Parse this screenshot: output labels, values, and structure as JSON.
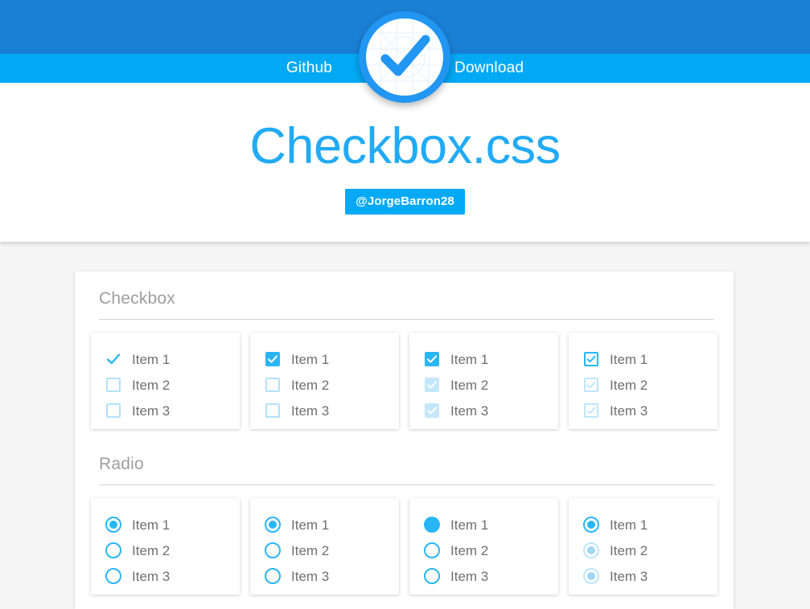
{
  "colors": {
    "top_band": "#1b7fd4",
    "nav_band": "#03a9f4",
    "accent": "#29b6f6",
    "accent_faint": "#bfe5fb",
    "page_bg": "#f5f5f5",
    "heading_grey": "#9e9e9e",
    "label_grey": "#6f6f6f"
  },
  "header": {
    "logo_icon": "check-circle-logo",
    "nav": [
      {
        "label": "Github",
        "name": "nav-link-github"
      },
      {
        "label": "Download",
        "name": "nav-link-download"
      }
    ]
  },
  "hero": {
    "title": "Checkbox.css",
    "badge": "@JorgeBarron28"
  },
  "sections": [
    {
      "id": "checkbox",
      "title": "Checkbox",
      "cards": [
        {
          "style": "bare-check",
          "items": [
            {
              "label": "Item 1",
              "state": "checked"
            },
            {
              "label": "Item 2",
              "state": "unchecked"
            },
            {
              "label": "Item 3",
              "state": "unchecked"
            }
          ]
        },
        {
          "style": "solid-fill",
          "items": [
            {
              "label": "Item 1",
              "state": "checked"
            },
            {
              "label": "Item 2",
              "state": "unchecked"
            },
            {
              "label": "Item 3",
              "state": "unchecked"
            }
          ]
        },
        {
          "style": "solid-fill-faded",
          "items": [
            {
              "label": "Item 1",
              "state": "checked"
            },
            {
              "label": "Item 2",
              "state": "checked-faint"
            },
            {
              "label": "Item 3",
              "state": "checked-faint"
            }
          ]
        },
        {
          "style": "outline-check",
          "items": [
            {
              "label": "Item 1",
              "state": "checked"
            },
            {
              "label": "Item 2",
              "state": "checked-faint"
            },
            {
              "label": "Item 3",
              "state": "checked-faint"
            }
          ]
        }
      ]
    },
    {
      "id": "radio",
      "title": "Radio",
      "cards": [
        {
          "style": "ring-dot",
          "items": [
            {
              "label": "Item 1",
              "state": "selected"
            },
            {
              "label": "Item 2",
              "state": "unselected"
            },
            {
              "label": "Item 3",
              "state": "unselected"
            }
          ]
        },
        {
          "style": "ring-dot",
          "items": [
            {
              "label": "Item 1",
              "state": "selected"
            },
            {
              "label": "Item 2",
              "state": "unselected"
            },
            {
              "label": "Item 3",
              "state": "unselected"
            }
          ]
        },
        {
          "style": "solid-dot",
          "items": [
            {
              "label": "Item 1",
              "state": "selected-filled"
            },
            {
              "label": "Item 2",
              "state": "unselected"
            },
            {
              "label": "Item 3",
              "state": "unselected"
            }
          ]
        },
        {
          "style": "ring-dot-faded",
          "items": [
            {
              "label": "Item 1",
              "state": "selected"
            },
            {
              "label": "Item 2",
              "state": "selected-faint"
            },
            {
              "label": "Item 3",
              "state": "selected-faint"
            }
          ]
        }
      ]
    }
  ]
}
